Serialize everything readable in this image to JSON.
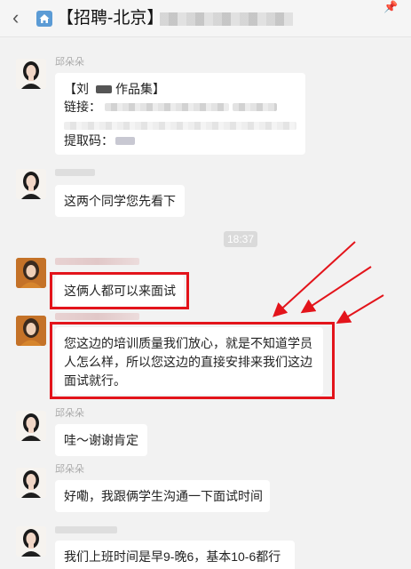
{
  "header": {
    "back_icon": "chevron-left-icon",
    "home_icon": "home-icon",
    "title": "【招聘-北京】",
    "pin_icon": "pin-icon"
  },
  "timestamp": "18:37",
  "messages": [
    {
      "sender": "邱朵朵",
      "avatar": "girl-avatar",
      "lines": [
        "【刘",
        "作品集】",
        "链接：",
        "提取码："
      ]
    },
    {
      "sender": "",
      "avatar": "girl-avatar",
      "text": "这两个同学您先看下"
    },
    {
      "sender": "",
      "avatar": "orange-avatar",
      "text": "这俩人都可以来面试",
      "highlighted": true
    },
    {
      "sender": "",
      "avatar": "orange-avatar",
      "lines": [
        "您这边的培训质量我们放心，就是不知道学员",
        "人怎么样，所以您这边的直接安排来我们这边",
        "面试就行。"
      ],
      "highlighted": true
    },
    {
      "sender": "邱朵朵",
      "avatar": "girl-avatar",
      "text": "哇～谢谢肯定"
    },
    {
      "sender": "邱朵朵",
      "avatar": "girl-avatar",
      "text": "好嘞，我跟俩学生沟通一下面试时间"
    },
    {
      "sender": "",
      "avatar": "girl-avatar",
      "text": "我们上班时间是早9-晚6，基本10-6都行"
    }
  ],
  "colors": {
    "highlight_box": "#e3141b",
    "arrow": "#e3141b",
    "background": "#f2f2f2",
    "bubble": "#ffffff"
  }
}
